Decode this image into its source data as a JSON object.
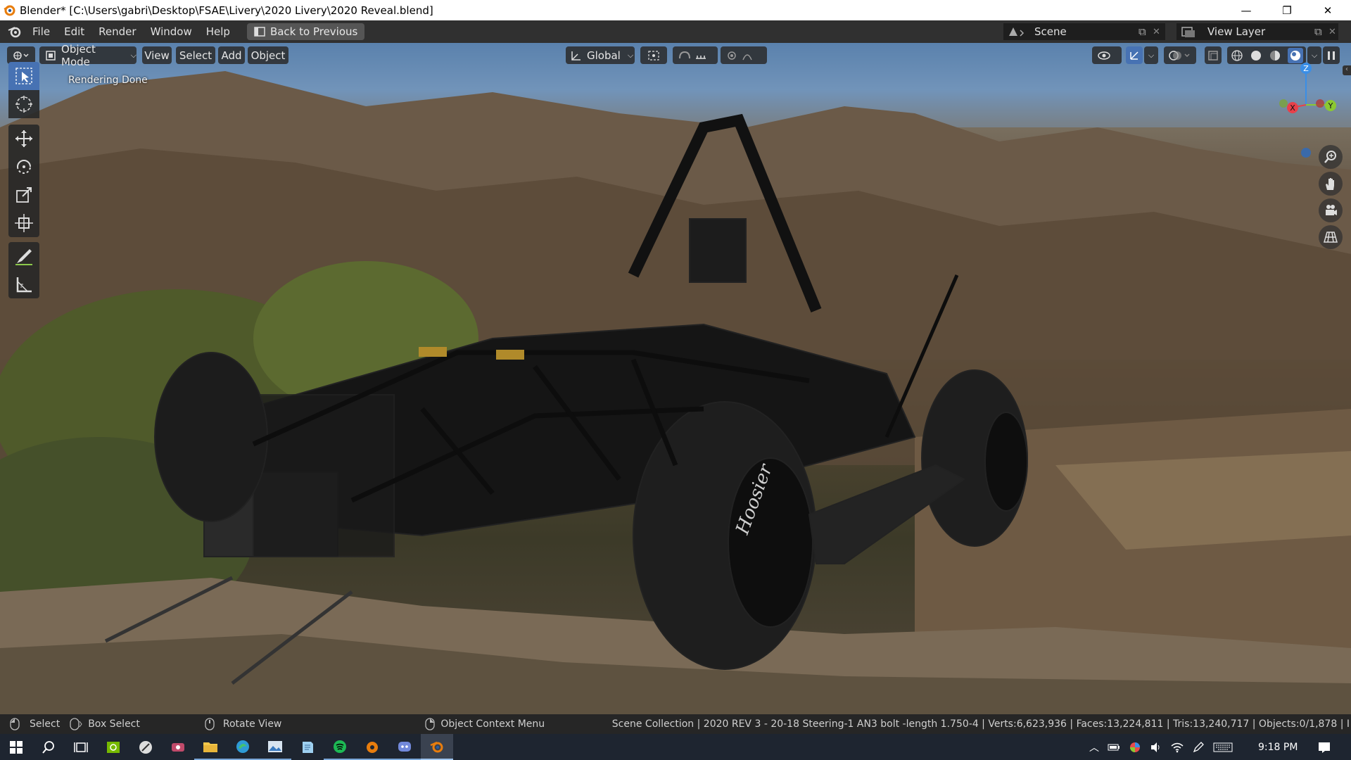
{
  "titlebar": {
    "title": "Blender* [C:\\Users\\gabri\\Desktop\\FSAE\\Livery\\2020 Livery\\2020 Reveal.blend]",
    "minimize": "—",
    "restore": "❐",
    "close": "✕"
  },
  "menu": {
    "items": [
      "File",
      "Edit",
      "Render",
      "Window",
      "Help"
    ],
    "back_label": "Back to Previous",
    "scene": "Scene",
    "view_layer": "View Layer"
  },
  "viewport_header": {
    "mode": "Object Mode",
    "menus": [
      "View",
      "Select",
      "Add",
      "Object"
    ],
    "orientation": "Global"
  },
  "viewport": {
    "status_text": "Rendering Done",
    "tire_brand": "Hoosier",
    "gizmo": {
      "x": "X",
      "y": "Y",
      "z": "Z"
    }
  },
  "statusbar": {
    "select": "Select",
    "box_select": "Box Select",
    "rotate_view": "Rotate View",
    "context_menu": "Object Context Menu",
    "stats": "Scene Collection | 2020 REV 3 - 20-18 Steering-1 AN3 bolt -length 1.750-4 | Verts:6,623,936 | Faces:13,224,811 | Tris:13,240,717 | Objects:0/1,878 | I"
  },
  "taskbar": {
    "time": "9:18 PM"
  },
  "colors": {
    "blender_orange": "#e87d0d",
    "active_tool": "#4772b3",
    "axis_x": "#e8404a",
    "axis_y": "#8bc832",
    "axis_z": "#3a8ee6"
  }
}
